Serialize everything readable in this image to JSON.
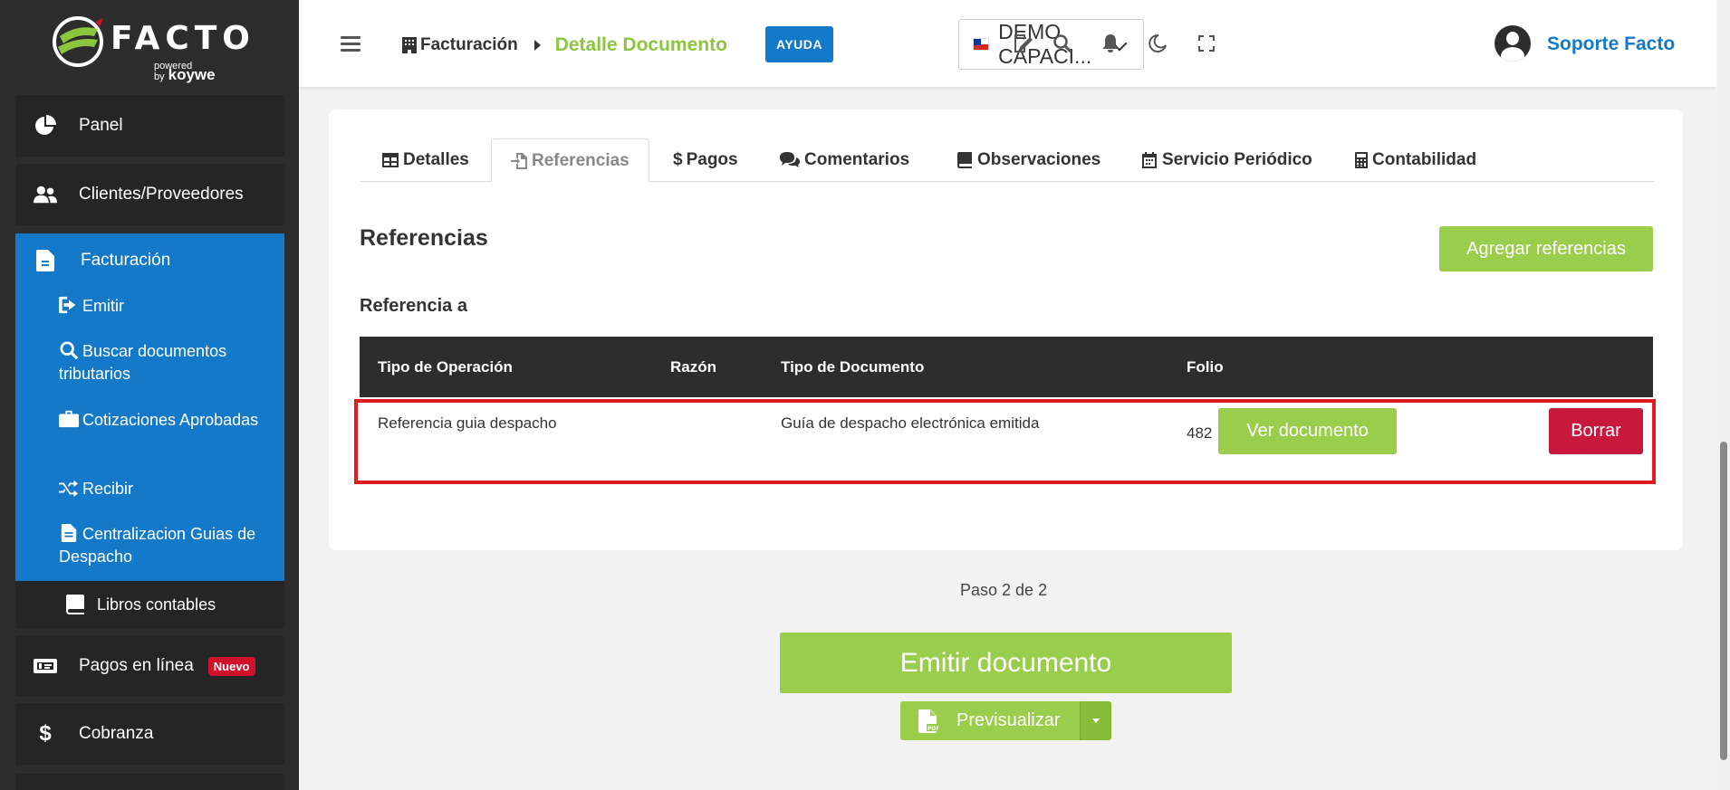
{
  "logo": {
    "name": "FACTO",
    "powered": "powered by",
    "brand": "koywe"
  },
  "sidebar": {
    "panel": "Panel",
    "clientes": "Clientes/Proveedores",
    "facturacion": "Facturación",
    "sub": [
      {
        "label": "Emitir",
        "icon": "sign-out-icon"
      },
      {
        "label": "Buscar documentos tributarios",
        "icon": "search-icon"
      },
      {
        "label": "Cotizaciones Aprobadas",
        "icon": "briefcase-icon"
      },
      {
        "label": "Recibir",
        "icon": "shuffle-icon"
      },
      {
        "label": "Centralizacion Guias de Despacho",
        "icon": "file-icon"
      }
    ],
    "libros": "Libros contables",
    "pagos": "Pagos en línea",
    "pagos_badge": "Nuevo",
    "cobranza": "Cobranza"
  },
  "header": {
    "breadcrumb_1": "Facturación",
    "breadcrumb_2": "Detalle Documento",
    "help": "AYUDA",
    "company": "DEMO CAPACI...",
    "user": "Soporte Facto"
  },
  "tabs": [
    {
      "label": "Detalles",
      "icon": "table-icon"
    },
    {
      "label": "Referencias",
      "icon": "file-import-icon",
      "active": true
    },
    {
      "label": "Pagos",
      "icon": "dollar-icon"
    },
    {
      "label": "Comentarios",
      "icon": "comments-icon"
    },
    {
      "label": "Observaciones",
      "icon": "book-icon"
    },
    {
      "label": "Servicio Periódico",
      "icon": "calendar-icon"
    },
    {
      "label": "Contabilidad",
      "icon": "calculator-icon"
    }
  ],
  "section": {
    "title": "Referencias",
    "add_button": "Agregar referencias",
    "subtitle": "Referencia a"
  },
  "table": {
    "headers": [
      "Tipo de Operación",
      "Razón",
      "Tipo de Documento",
      "Folio"
    ],
    "rows": [
      {
        "tipo_operacion": "Referencia guia despacho",
        "razon": "",
        "tipo_documento": "Guía de despacho electrónica emitida",
        "folio": "482",
        "view_button": "Ver documento",
        "delete_button": "Borrar"
      }
    ]
  },
  "footer": {
    "step": "Paso 2 de 2",
    "emit_button": "Emitir documento",
    "preview_button": "Previsualizar"
  },
  "colors": {
    "sidebar": "#2d2d2d",
    "accent_blue": "#1479c9",
    "accent_green": "#9acd4c",
    "danger": "#c8193c",
    "highlight": "#e11b22"
  }
}
